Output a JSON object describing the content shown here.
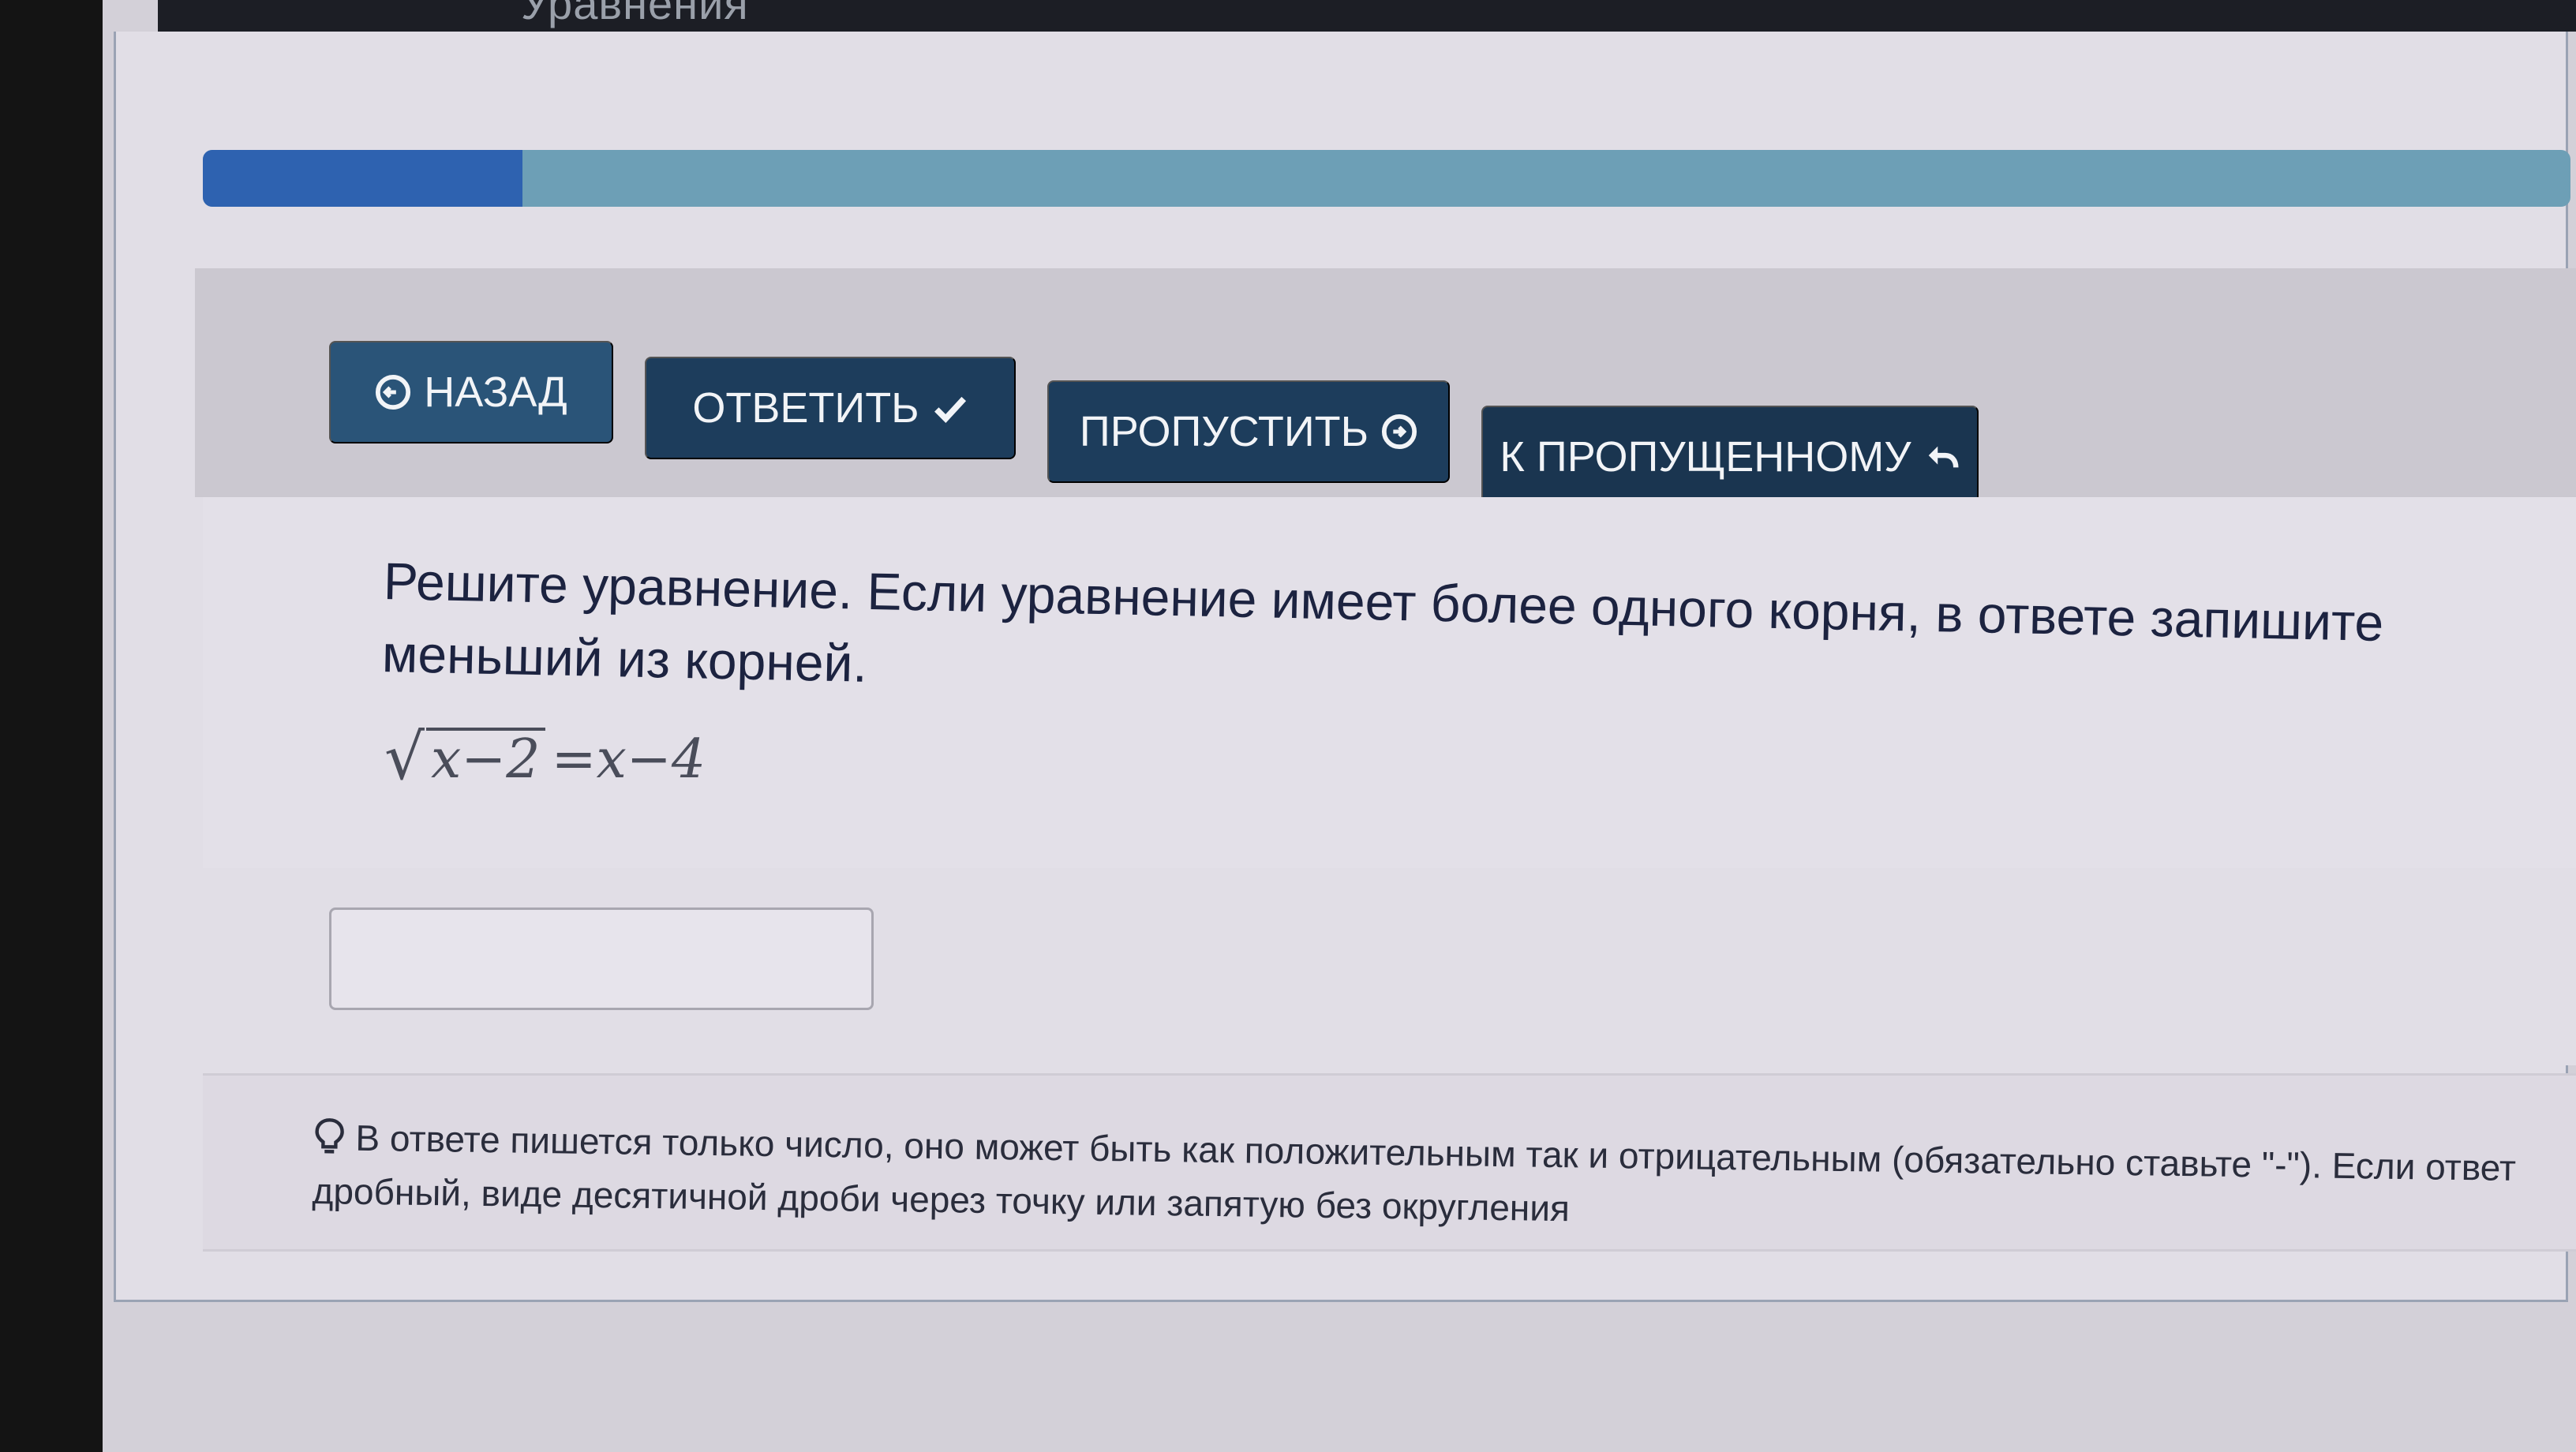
{
  "header": {
    "title": "Уравнения"
  },
  "progress": {
    "fraction": 0.135
  },
  "toolbar": {
    "back_label": "НАЗАД",
    "answer_label": "ОТВЕТИТЬ",
    "skip_label": "ПРОПУСТИТЬ",
    "to_skipped_label": "К ПРОПУЩЕННОМУ"
  },
  "question": {
    "text": "Решите уравнение. Если уравнение имеет более одного корня, в ответе запишите меньший из корней.",
    "equation": {
      "radicand": "x−2",
      "rest": "=x−4"
    }
  },
  "answer": {
    "value": "",
    "placeholder": ""
  },
  "hint": {
    "text": "В ответе пишется только число, оно может быть как положительным так и отрицательным (обязательно ставьте \"-\"). Если ответ дробный, виде десятичной дроби через точку или запятую без округления"
  },
  "colors": {
    "button_bg": "#1d3d5c",
    "progress_fill": "#2e62b0",
    "progress_track": "#6d9fb6"
  },
  "icons": {
    "back": "circle-arrow-left-icon",
    "answer": "check-icon",
    "skip": "circle-arrow-right-icon",
    "to_skipped": "reply-arrow-icon",
    "hint": "lightbulb-icon"
  }
}
